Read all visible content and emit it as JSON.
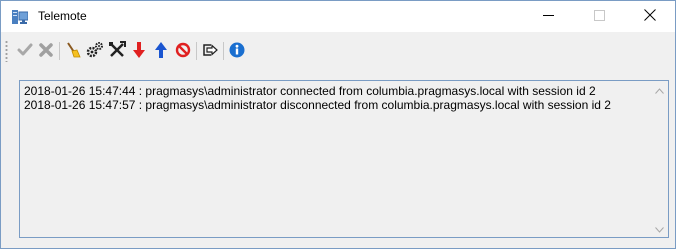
{
  "window": {
    "title": "Telemote",
    "icons": {
      "app": "app-icon",
      "minimize": "minimize-icon",
      "maximize": "maximize-icon",
      "close": "close-icon"
    }
  },
  "toolbar": {
    "buttons": [
      {
        "name": "check",
        "icon": "check-icon",
        "enabled": false
      },
      {
        "name": "cancel",
        "icon": "x-icon",
        "enabled": false
      },
      {
        "name": "clear",
        "icon": "broom-icon",
        "enabled": true
      },
      {
        "name": "settings",
        "icon": "gears-icon",
        "enabled": true
      },
      {
        "name": "tools",
        "icon": "tools-icon",
        "enabled": true
      },
      {
        "name": "download",
        "icon": "arrow-down-icon",
        "enabled": true,
        "color": "#e02020"
      },
      {
        "name": "upload",
        "icon": "arrow-up-icon",
        "enabled": true,
        "color": "#1a55d0"
      },
      {
        "name": "stop",
        "icon": "prohibited-icon",
        "enabled": true,
        "color": "#e02020"
      },
      {
        "name": "exit",
        "icon": "exit-icon",
        "enabled": true
      },
      {
        "name": "info",
        "icon": "info-icon",
        "enabled": true,
        "color": "#1a6fd0"
      }
    ]
  },
  "log": {
    "lines": [
      "2018-01-26 15:47:44 : pragmasys\\administrator connected from columbia.pragmasys.local with session id 2",
      "2018-01-26 15:47:57 : pragmasys\\administrator disconnected from columbia.pragmasys.local with session id 2"
    ]
  }
}
